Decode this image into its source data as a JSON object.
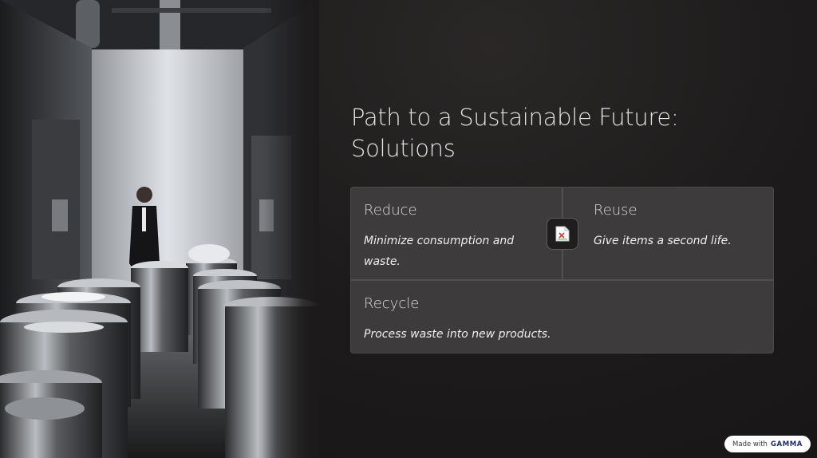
{
  "slide": {
    "title": "Path to a Sustainable Future: Solutions",
    "photo": {
      "description_icon": "photo-waste-room"
    }
  },
  "cards": {
    "reduce": {
      "heading": "Reduce",
      "body": "Minimize consumption and waste."
    },
    "reuse": {
      "heading": "Reuse",
      "body": "Give items a second life."
    },
    "recycle": {
      "heading": "Recycle",
      "body": "Process waste into new products."
    },
    "center_icon": "broken-image-icon"
  },
  "badge": {
    "prefix": "Made with",
    "brand": "GAMMA"
  },
  "colors": {
    "background": "#1c1a1a",
    "card": "#3d3b3b",
    "title": "#e6e2e2",
    "brand": "#1b2a6b"
  }
}
